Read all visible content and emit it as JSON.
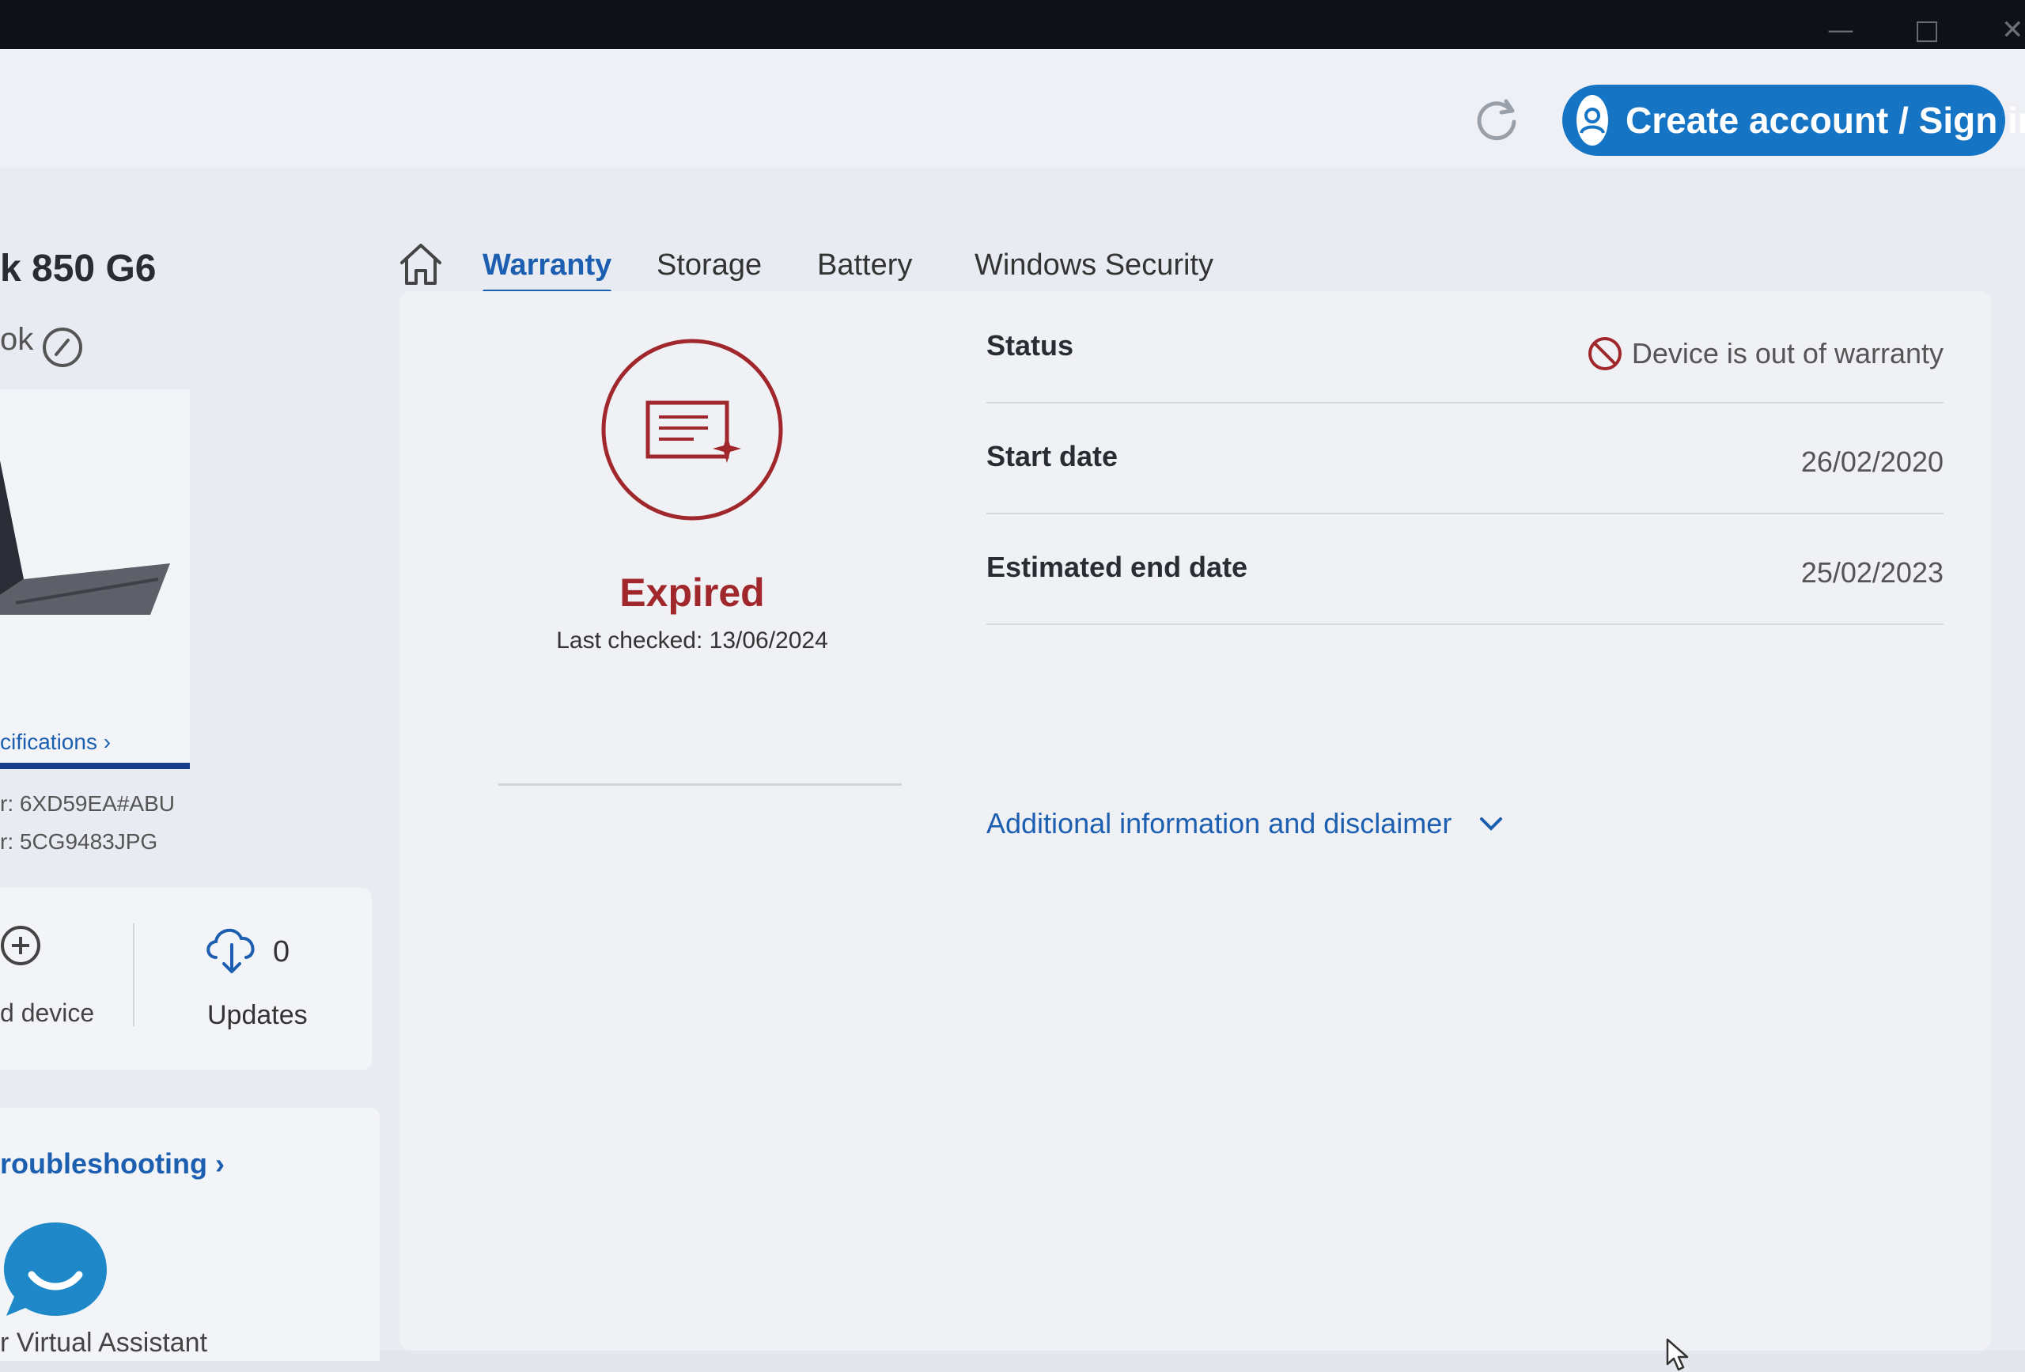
{
  "header": {
    "account_label": "Create account / Sign in",
    "account_icon": "user-icon",
    "refresh_icon": "refresh-icon",
    "accent_color": "#1674c5"
  },
  "window_controls": {
    "minimize": "—",
    "maximize": "□",
    "close": "✕"
  },
  "sidebar": {
    "device_name": "k 850 G6",
    "device_sub": "ok",
    "specifications_link": "cifications ›",
    "product_number": "r: 6XD59EA#ABU",
    "serial_number": "r: 5CG9483JPG",
    "add_device_label": "d device",
    "updates_count": "0",
    "updates_label": "Updates",
    "troubleshooting_link": "roubleshooting ›",
    "virtual_assistant_label": "r Virtual Assistant"
  },
  "tabs": [
    {
      "label": "Warranty",
      "active": true
    },
    {
      "label": "Storage",
      "active": false
    },
    {
      "label": "Battery",
      "active": false
    },
    {
      "label": "Windows Security",
      "active": false
    }
  ],
  "warranty": {
    "state_label": "Expired",
    "last_checked": "Last checked: 13/06/2024",
    "status_color": "#a0282c",
    "rows": [
      {
        "label": "Status",
        "value": "Device is out of warranty"
      },
      {
        "label": "Start date",
        "value": "26/02/2020"
      },
      {
        "label": "Estimated end date",
        "value": "25/02/2023"
      }
    ],
    "disclaimer_link": "Additional information and disclaimer"
  }
}
